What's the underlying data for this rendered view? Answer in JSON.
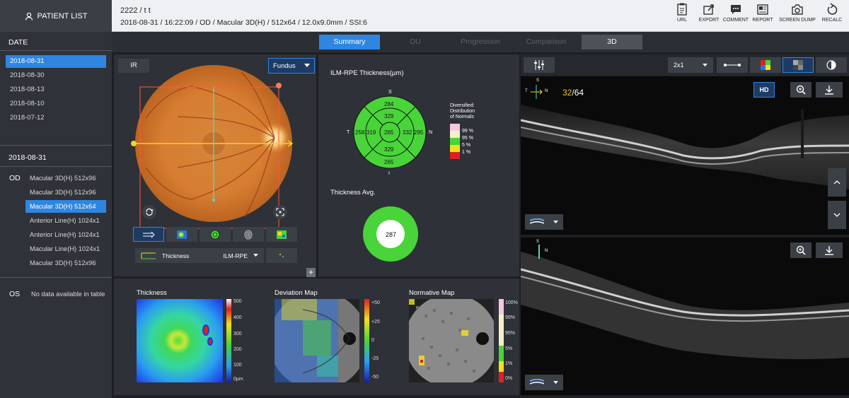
{
  "header": {
    "patient_list_label": "PATIENT LIST",
    "title": "2222 / t t",
    "subtitle": "2018-08-31 / 16:22:09 / OD / Macular 3D(H) / 512x64 / 12.0x9.0mm / SSI:6",
    "tools": [
      {
        "label": "URL",
        "icon": "clipboard-icon"
      },
      {
        "label": "EXPORT",
        "icon": "export-icon"
      },
      {
        "label": "COMMENT",
        "icon": "comment-icon"
      },
      {
        "label": "REPORT",
        "icon": "report-icon"
      },
      {
        "label": "SCREEN DUMP",
        "icon": "camera-icon"
      },
      {
        "label": "RECALC",
        "icon": "recalc-icon"
      }
    ]
  },
  "sidebar": {
    "date_title": "DATE",
    "dates": [
      "2018-08-31",
      "2018-08-30",
      "2018-08-13",
      "2018-08-10",
      "2018-07-12"
    ],
    "selected_date": "2018-08-31",
    "session_date": "2018-08-31",
    "od_label": "OD",
    "od_scans": [
      "Macular 3D(H) 512x96",
      "Macular 3D(H) 512x96",
      "Macular 3D(H) 512x64",
      "Anterior Line(H) 1024x1",
      "Anterior Line(H) 1024x1",
      "Macular Line(H) 1024x1",
      "Macular 3D(H) 512x96"
    ],
    "selected_scan_index": 2,
    "os_label": "OS",
    "os_empty": "No data available in table"
  },
  "tabs": [
    "Summary",
    "OU",
    "Progression",
    "Comparison",
    "3D"
  ],
  "fundus_panel": {
    "ir_label": "IR",
    "view_select": "Fundus",
    "thickness_label": "Thickness",
    "layer_select": "ILM-RPE",
    "plus": "+"
  },
  "etdrs": {
    "title": "ILM-RPE Thickness(µm)",
    "dir_s": "S",
    "dir_i": "I",
    "dir_t": "T",
    "dir_n": "N",
    "center": "265",
    "inner_s": "329",
    "inner_i": "329",
    "inner_t": "319",
    "inner_n": "332",
    "outer_s": "284",
    "outer_i": "265",
    "outer_t": "258",
    "outer_n": "295",
    "legend_title_1": "Diversified:",
    "legend_title_2": "Distribution",
    "legend_title_3": "of Normals",
    "legend_items": [
      {
        "label": "99 %",
        "color": "#f4c9e0"
      },
      {
        "label": "95 %",
        "color": "#f3f0c9"
      },
      {
        "label": "5 %",
        "color": "#49d43a"
      },
      {
        "label": "1 %",
        "color": "#f1e21b"
      },
      {
        "label": "",
        "color": "#e02020"
      }
    ]
  },
  "thickness_avg": {
    "title": "Thickness Avg.",
    "value": "287"
  },
  "maps": {
    "thickness_title": "Thickness",
    "thickness_scale": [
      "500",
      "400",
      "300",
      "200",
      "100",
      "0µm"
    ],
    "deviation_title": "Deviation Map",
    "deviation_scale": [
      "+50",
      "+25",
      "0",
      "-25",
      "-50"
    ],
    "normative_title": "Normative Map",
    "normative_scale": [
      "100%",
      "99%",
      "95%",
      "5%",
      "1%",
      "0%"
    ]
  },
  "right_panel": {
    "layout_select": "2x1",
    "slice_current": "32",
    "slice_total": "/64",
    "hd_label": "HD",
    "orient_s": "S",
    "orient_t": "T",
    "orient_n": "N"
  },
  "colors": {
    "accent": "#2f86e0",
    "panel": "#2e3137",
    "sidebar": "#2f3238",
    "normal_green": "#49d43a"
  }
}
